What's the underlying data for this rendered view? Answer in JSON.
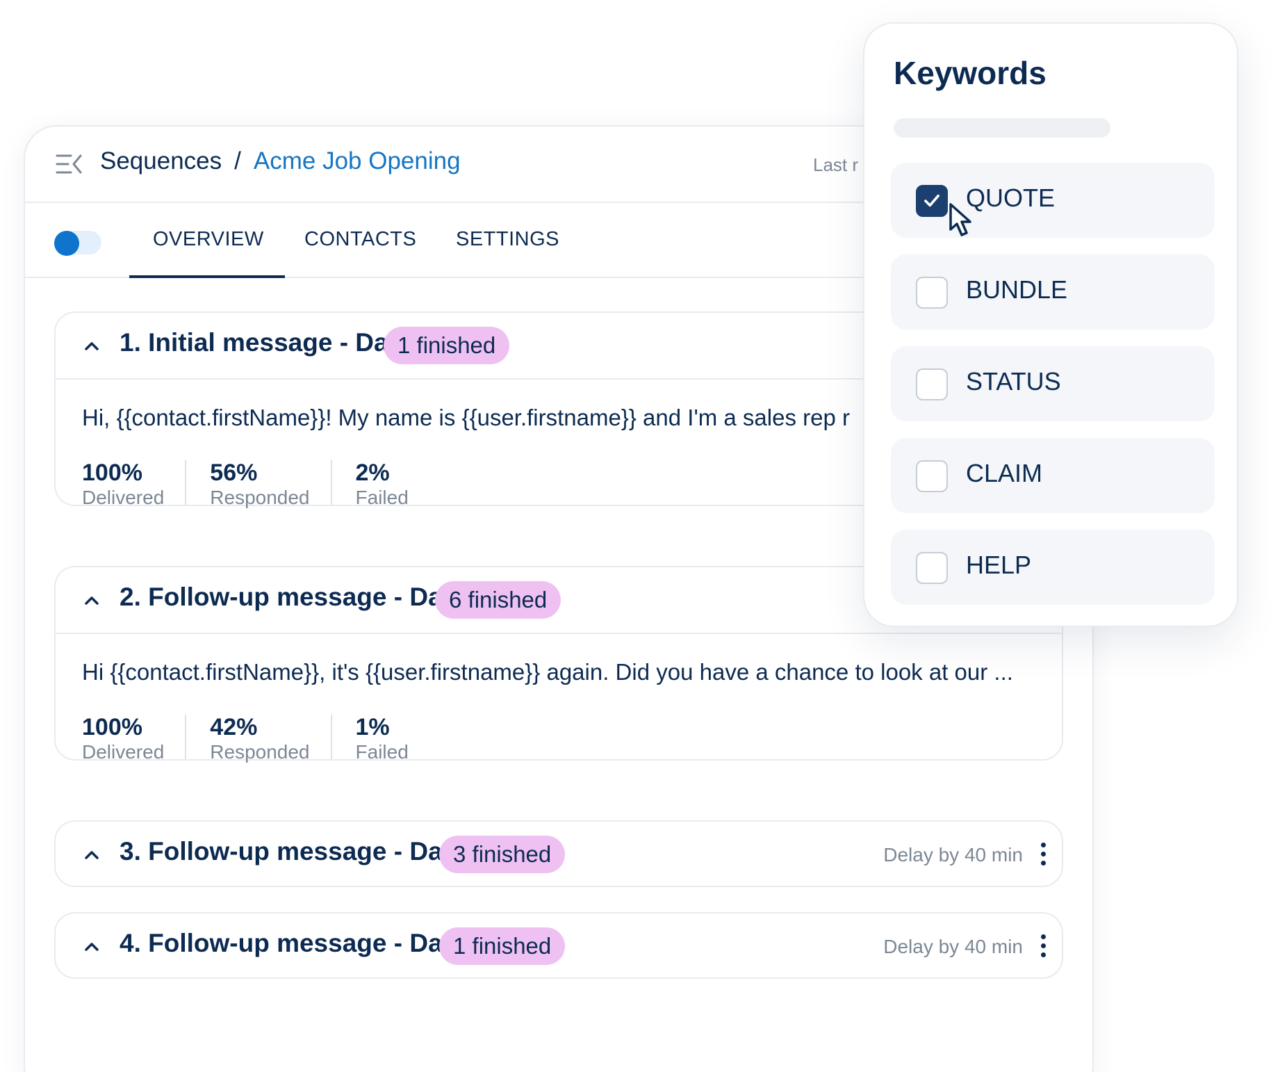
{
  "breadcrumb": {
    "root": "Sequences",
    "separator": "/",
    "current": "Acme Job Opening"
  },
  "last_run_label": "Last r",
  "tabs": [
    {
      "label": "OVERVIEW",
      "active": true
    },
    {
      "label": "CONTACTS",
      "active": false
    },
    {
      "label": "SETTINGS",
      "active": false
    }
  ],
  "toggle": {
    "on": true
  },
  "steps": [
    {
      "title": "1. Initial message - Day 1",
      "badge": "1 finished",
      "expanded": true,
      "message": "Hi, {{contact.firstName}}! My name is {{user.firstname}} and I'm a sales rep r",
      "stats": [
        {
          "value": "100%",
          "label": "Delivered"
        },
        {
          "value": "56%",
          "label": "Responded"
        },
        {
          "value": "2%",
          "label": "Failed"
        }
      ]
    },
    {
      "title": "2. Follow-up message - Day 1",
      "badge": "6 finished",
      "expanded": true,
      "message": "Hi {{contact.firstName}}, it's {{user.firstname}} again. Did you have a chance to look at our ...",
      "stats": [
        {
          "value": "100%",
          "label": "Delivered"
        },
        {
          "value": "42%",
          "label": "Responded"
        },
        {
          "value": "1%",
          "label": "Failed"
        }
      ]
    },
    {
      "title": "3. Follow-up message - Day 2",
      "badge": "3 finished",
      "expanded": false,
      "delay": "Delay by 40 min"
    },
    {
      "title": "4. Follow-up message - Day 5",
      "badge": "1 finished",
      "expanded": false,
      "delay": "Delay by 40 min"
    }
  ],
  "keywords": {
    "title": "Keywords",
    "items": [
      {
        "label": "QUOTE",
        "checked": true
      },
      {
        "label": "BUNDLE",
        "checked": false
      },
      {
        "label": "STATUS",
        "checked": false
      },
      {
        "label": "CLAIM",
        "checked": false
      },
      {
        "label": "HELP",
        "checked": false
      }
    ]
  },
  "colors": {
    "navy": "#0d2b52",
    "link_blue": "#1576c4",
    "badge_pink": "#efc1f2",
    "muted_gray": "#7c8795",
    "checkbox_checked": "#1b3f6e",
    "toggle_blue": "#0f74cc"
  },
  "icons": [
    "collapse-sidebar-icon",
    "chevron-up-icon",
    "kebab-menu-icon",
    "checkmark-icon",
    "mouse-cursor-icon"
  ]
}
